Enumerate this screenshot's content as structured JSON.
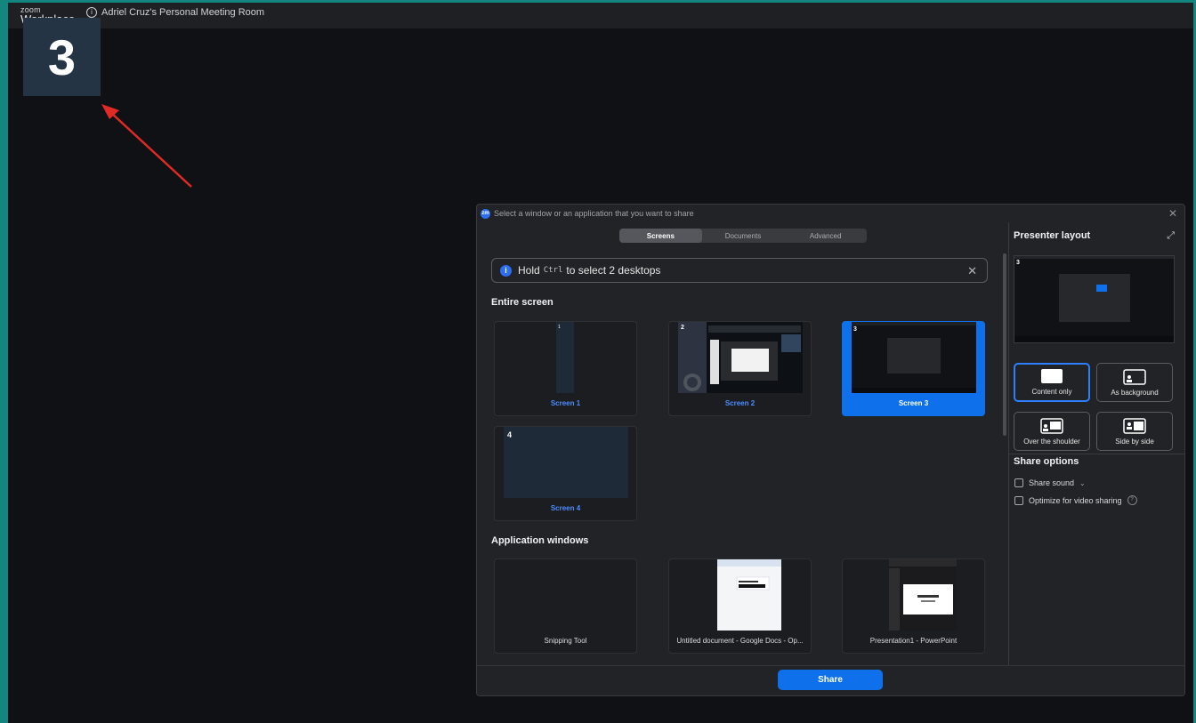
{
  "app": {
    "logo_top": "zoom",
    "logo_bottom": "Workplace",
    "meeting_room": "Adriel Cruz's Personal Meeting Room",
    "screen_identifier": "3"
  },
  "dialog": {
    "title": "Select a window or an application that you want to share",
    "tabs": [
      {
        "label": "Screens",
        "active": true
      },
      {
        "label": "Documents",
        "active": false
      },
      {
        "label": "Advanced",
        "active": false
      }
    ],
    "tip": {
      "prefix": "Hold",
      "key": "Ctrl",
      "suffix": "to select 2 desktops"
    },
    "entire_screen_title": "Entire screen",
    "screens": [
      {
        "label": "Screen 1",
        "number": "1",
        "selected": false
      },
      {
        "label": "Screen 2",
        "number": "2",
        "selected": false
      },
      {
        "label": "Screen 3",
        "number": "3",
        "selected": true
      },
      {
        "label": "Screen 4",
        "number": "4",
        "selected": false
      }
    ],
    "app_windows_title": "Application windows",
    "apps": [
      {
        "label": "Snipping Tool"
      },
      {
        "label": "Untitled document - Google Docs - Op..."
      },
      {
        "label": "Presentation1 - PowerPoint"
      }
    ],
    "share_button": "Share"
  },
  "presenter": {
    "title": "Presenter layout",
    "preview_number": "3",
    "layouts": [
      {
        "label": "Content only",
        "selected": true
      },
      {
        "label": "As background",
        "selected": false
      },
      {
        "label": "Over the shoulder",
        "selected": false
      },
      {
        "label": "Side by side",
        "selected": false
      }
    ],
    "share_options_title": "Share options",
    "options": [
      {
        "label": "Share sound",
        "checked": false
      },
      {
        "label": "Optimize for video sharing",
        "checked": false
      }
    ]
  },
  "colors": {
    "accent": "#0e71eb",
    "frame": "#13877f"
  }
}
